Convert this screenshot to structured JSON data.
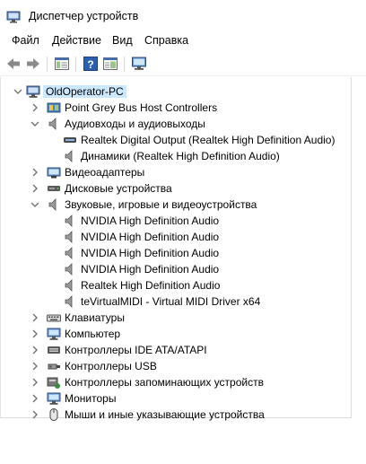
{
  "window": {
    "title": "Диспетчер устройств"
  },
  "menu": [
    "Файл",
    "Действие",
    "Вид",
    "Справка"
  ],
  "tree": {
    "root": "OldOperator-PC",
    "categories": [
      {
        "label": "Point Grey Bus Host Controllers",
        "expanded": false,
        "icon": "bus-controller-icon"
      },
      {
        "label": "Аудиовходы и аудиовыходы",
        "expanded": true,
        "icon": "audio-io-icon",
        "children": [
          {
            "label": "Realtek Digital Output (Realtek High Definition Audio)",
            "icon": "digital-output-icon"
          },
          {
            "label": "Динамики (Realtek High Definition Audio)",
            "icon": "speaker-icon"
          }
        ]
      },
      {
        "label": "Видеоадаптеры",
        "expanded": false,
        "icon": "display-adapter-icon"
      },
      {
        "label": "Дисковые устройства",
        "expanded": false,
        "icon": "disk-drive-icon"
      },
      {
        "label": "Звуковые, игровые и видеоустройства",
        "expanded": true,
        "icon": "sound-devices-icon",
        "children": [
          {
            "label": "NVIDIA High Definition Audio",
            "icon": "speaker-icon"
          },
          {
            "label": "NVIDIA High Definition Audio",
            "icon": "speaker-icon"
          },
          {
            "label": "NVIDIA High Definition Audio",
            "icon": "speaker-icon"
          },
          {
            "label": "NVIDIA High Definition Audio",
            "icon": "speaker-icon"
          },
          {
            "label": "Realtek High Definition Audio",
            "icon": "speaker-icon"
          },
          {
            "label": "teVirtualMIDI - Virtual MIDI Driver x64",
            "icon": "speaker-icon"
          }
        ]
      },
      {
        "label": "Клавиатуры",
        "expanded": false,
        "icon": "keyboard-icon"
      },
      {
        "label": "Компьютер",
        "expanded": false,
        "icon": "computer-icon"
      },
      {
        "label": "Контроллеры IDE ATA/ATAPI",
        "expanded": false,
        "icon": "ide-controller-icon"
      },
      {
        "label": "Контроллеры USB",
        "expanded": false,
        "icon": "usb-controller-icon"
      },
      {
        "label": "Контроллеры запоминающих устройств",
        "expanded": false,
        "icon": "storage-controller-icon"
      },
      {
        "label": "Мониторы",
        "expanded": false,
        "icon": "monitor-icon"
      },
      {
        "label": "Мыши и иные указывающие устройства",
        "expanded": false,
        "icon": "mouse-icon"
      }
    ]
  },
  "colors": {
    "selection": "#cce8ff",
    "chevron": "#6e6e6e",
    "accent": "#2b6cc4"
  }
}
